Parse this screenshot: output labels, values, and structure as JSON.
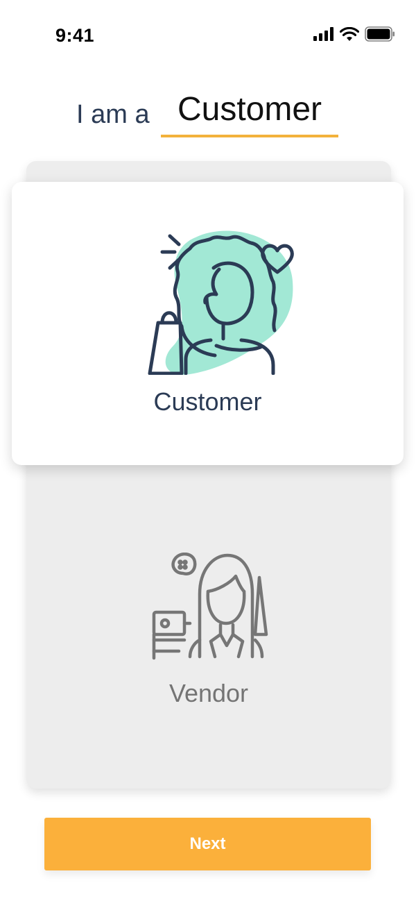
{
  "status_bar": {
    "time": "9:41",
    "icons": [
      "signal-icon",
      "wifi-icon",
      "battery-icon"
    ]
  },
  "headline": {
    "prefix": "I am a",
    "selected_role": "Customer"
  },
  "options": [
    {
      "label": "Customer",
      "icon": "customer-icon",
      "selected": true
    },
    {
      "label": "Vendor",
      "icon": "vendor-icon",
      "selected": false
    }
  ],
  "next_label": "Next",
  "colors": {
    "accent": "#fbb03b",
    "underline": "#f3b23b",
    "title_text": "#2b3b55",
    "illustration_fill": "#a2e8d5",
    "muted": "#747474",
    "panel_bg": "#ededed"
  }
}
